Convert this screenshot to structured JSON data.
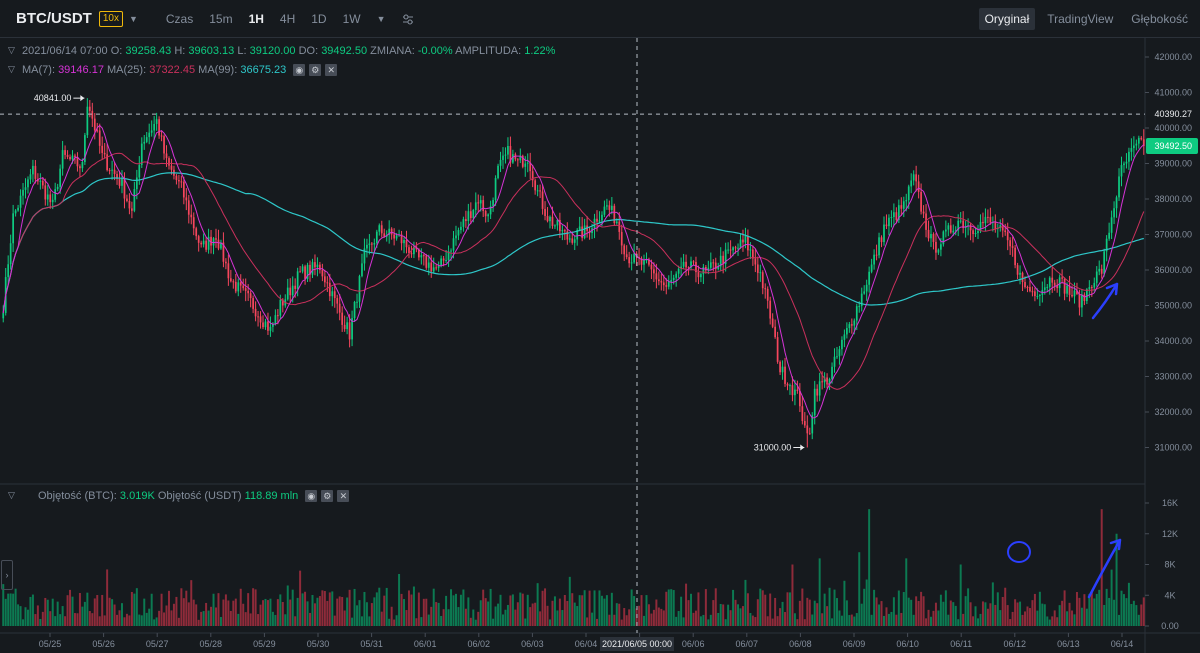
{
  "header": {
    "pair": "BTC/USDT",
    "leverage": "10x",
    "timeframes": [
      "Czas",
      "15m",
      "1H",
      "4H",
      "1D",
      "1W"
    ],
    "active_tf": "1H",
    "views": [
      "Oryginał",
      "TradingView",
      "Głębokość"
    ],
    "active_view": "Oryginał"
  },
  "ohlc": {
    "date": "2021/06/14 07:00",
    "o_label": "O:",
    "o": "39258.43",
    "h_label": "H:",
    "h": "39603.13",
    "l_label": "L:",
    "l": "39120.00",
    "c_label": "DO:",
    "c": "39492.50",
    "chg_label": "ZMIANA:",
    "chg": "-0.00%",
    "amp_label": "AMPLITUDA:",
    "amp": "1.22%"
  },
  "ma": {
    "ma7_label": "MA(7):",
    "ma7": "39146.17",
    "ma25_label": "MA(25):",
    "ma25": "37322.45",
    "ma99_label": "MA(99):",
    "ma99": "36675.23"
  },
  "volume": {
    "label": "Objętość (BTC):",
    "btc": "3.019K",
    "usdt_label": "Objętość (USDT)",
    "usdt": "118.89 mln"
  },
  "crosshair": {
    "price": "40390.27",
    "time": "2021/06/05 00:00"
  },
  "last_price": "39492.50",
  "colors": {
    "up": "#0ecb81",
    "down": "#f6465d",
    "ma7": "#d633d6",
    "ma25": "#c9305c",
    "ma99": "#2ec7c9",
    "annotation": "#2b3fff"
  },
  "chart_data": {
    "type": "candlestick",
    "y_ticks": [
      31000,
      32000,
      33000,
      34000,
      35000,
      36000,
      37000,
      38000,
      39000,
      40000,
      41000,
      42000
    ],
    "y_tick_labels": [
      "31000.00",
      "32000.00",
      "33000.00",
      "34000.00",
      "35000.00",
      "36000.00",
      "37000.00",
      "38000.00",
      "39000.00",
      "40000.00",
      "41000.00",
      "42000.00"
    ],
    "vol_ticks": [
      0,
      4,
      8,
      12,
      16
    ],
    "vol_tick_labels": [
      "0.00",
      "4K",
      "8K",
      "12K",
      "16K"
    ],
    "x_labels": [
      "05/25",
      "05/26",
      "05/27",
      "05/28",
      "05/29",
      "05/30",
      "05/31",
      "06/01",
      "06/02",
      "06/03",
      "06/04",
      "06/05",
      "06/06",
      "06/07",
      "06/08",
      "06/09",
      "06/10",
      "06/11",
      "06/12",
      "06/13",
      "06/14"
    ],
    "close_path": [
      [
        0,
        35000
      ],
      [
        4,
        37500
      ],
      [
        12,
        38800
      ],
      [
        20,
        37800
      ],
      [
        24,
        39200
      ],
      [
        32,
        38900
      ],
      [
        34,
        40841
      ],
      [
        40,
        39200
      ],
      [
        48,
        38400
      ],
      [
        52,
        37600
      ],
      [
        56,
        39600
      ],
      [
        62,
        40200
      ],
      [
        66,
        39000
      ],
      [
        72,
        38300
      ],
      [
        80,
        36600
      ],
      [
        86,
        37000
      ],
      [
        92,
        35700
      ],
      [
        100,
        35100
      ],
      [
        108,
        34300
      ],
      [
        112,
        35000
      ],
      [
        120,
        35900
      ],
      [
        128,
        36100
      ],
      [
        136,
        34800
      ],
      [
        140,
        34200
      ],
      [
        146,
        36400
      ],
      [
        152,
        37100
      ],
      [
        160,
        36900
      ],
      [
        168,
        36300
      ],
      [
        176,
        36000
      ],
      [
        184,
        37100
      ],
      [
        192,
        38000
      ],
      [
        196,
        37500
      ],
      [
        200,
        38800
      ],
      [
        204,
        39300
      ],
      [
        208,
        39000
      ],
      [
        212,
        39200
      ],
      [
        216,
        38200
      ],
      [
        220,
        37500
      ],
      [
        228,
        36900
      ],
      [
        236,
        37100
      ],
      [
        240,
        37500
      ],
      [
        244,
        37800
      ],
      [
        248,
        37400
      ],
      [
        252,
        36400
      ],
      [
        260,
        36100
      ],
      [
        268,
        35500
      ],
      [
        276,
        36100
      ],
      [
        284,
        35900
      ],
      [
        292,
        36400
      ],
      [
        300,
        36800
      ],
      [
        306,
        35900
      ],
      [
        310,
        34700
      ],
      [
        314,
        33200
      ],
      [
        318,
        32800
      ],
      [
        322,
        32300
      ],
      [
        325,
        31000
      ],
      [
        328,
        32600
      ],
      [
        334,
        33000
      ],
      [
        340,
        34100
      ],
      [
        346,
        35100
      ],
      [
        352,
        36300
      ],
      [
        356,
        37200
      ],
      [
        360,
        37500
      ],
      [
        364,
        37800
      ],
      [
        368,
        38600
      ],
      [
        372,
        37500
      ],
      [
        376,
        36600
      ],
      [
        380,
        36900
      ],
      [
        386,
        37400
      ],
      [
        392,
        37200
      ],
      [
        398,
        37400
      ],
      [
        404,
        37000
      ],
      [
        408,
        36500
      ],
      [
        412,
        35600
      ],
      [
        416,
        35400
      ],
      [
        420,
        35500
      ],
      [
        424,
        35800
      ],
      [
        428,
        35600
      ],
      [
        432,
        35300
      ],
      [
        436,
        35100
      ],
      [
        440,
        35700
      ],
      [
        444,
        36000
      ],
      [
        448,
        37500
      ],
      [
        452,
        38800
      ],
      [
        456,
        39300
      ],
      [
        460,
        39600
      ]
    ],
    "annotations": [
      {
        "text": "40841.00",
        "bar": 34,
        "price": 40841
      },
      {
        "text": "31000.00",
        "bar": 325,
        "price": 31000
      }
    ],
    "volume_spikes": [
      [
        120,
        0.45
      ],
      [
        284,
        0.3
      ],
      [
        319,
        0.5
      ],
      [
        330,
        0.55
      ],
      [
        346,
        0.6
      ],
      [
        350,
        0.95
      ],
      [
        365,
        0.55
      ],
      [
        387,
        0.5
      ],
      [
        444,
        0.95
      ],
      [
        450,
        0.75
      ]
    ]
  }
}
